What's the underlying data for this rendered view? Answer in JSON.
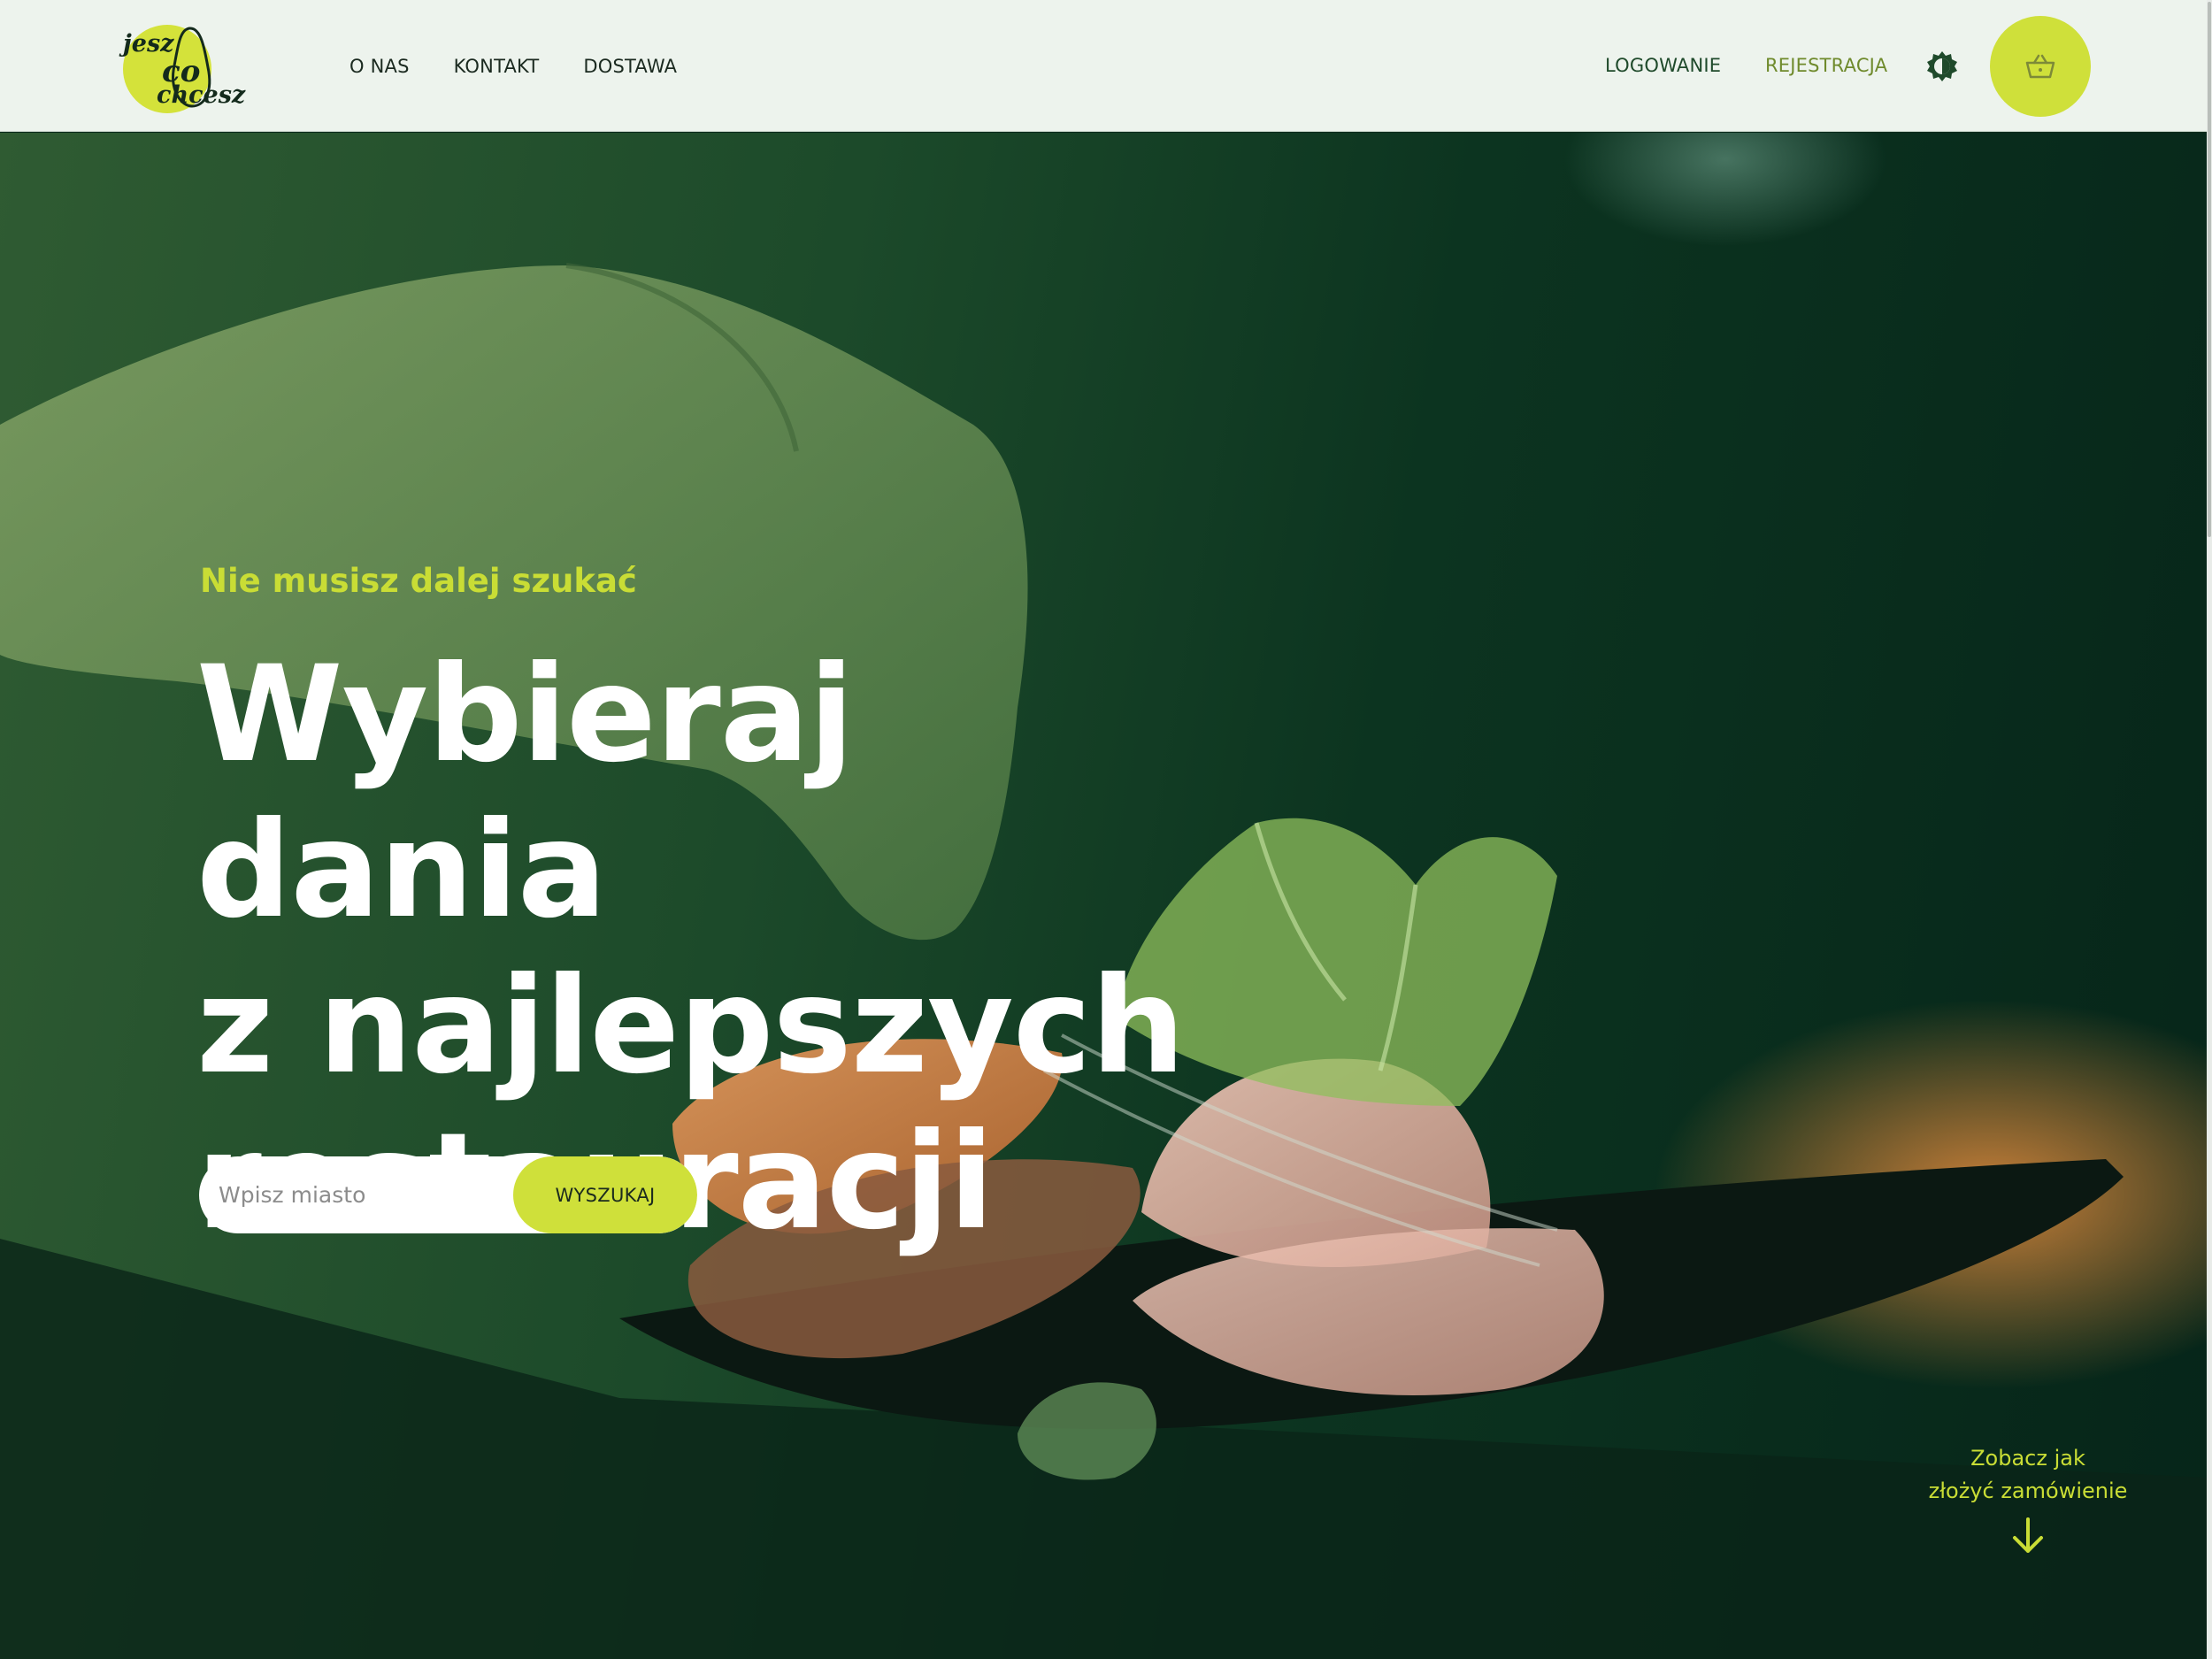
{
  "logo": {
    "line1": "jesz",
    "line2": "co",
    "line3": "chcesz",
    "accent": "#d4e23a"
  },
  "nav": {
    "items": [
      {
        "label": "O NAS"
      },
      {
        "label": "KONTAKT"
      },
      {
        "label": "DOSTAWA"
      }
    ]
  },
  "auth": {
    "login_label": "LOGOWANIE",
    "register_label": "REJESTRACJA"
  },
  "icons": {
    "theme": "theme-toggle-icon",
    "cart": "basket-icon",
    "scroll": "arrow-down-icon"
  },
  "hero": {
    "eyebrow": "Nie musisz dalej szukać",
    "headline": {
      "line1": "Wybieraj dania",
      "line2": "z najlepszych",
      "line3": "restauracji"
    },
    "search": {
      "placeholder": "Wpisz miasto",
      "value": "",
      "button_label": "WYSZUKAJ"
    },
    "how_to": {
      "line1": "Zobacz jak",
      "line2": "złożyć zamówienie"
    }
  },
  "colors": {
    "accent": "#cfe03a",
    "header_bg": "#edf3ed",
    "hero_bg": "#0c3420",
    "text_light": "#ffffff"
  }
}
